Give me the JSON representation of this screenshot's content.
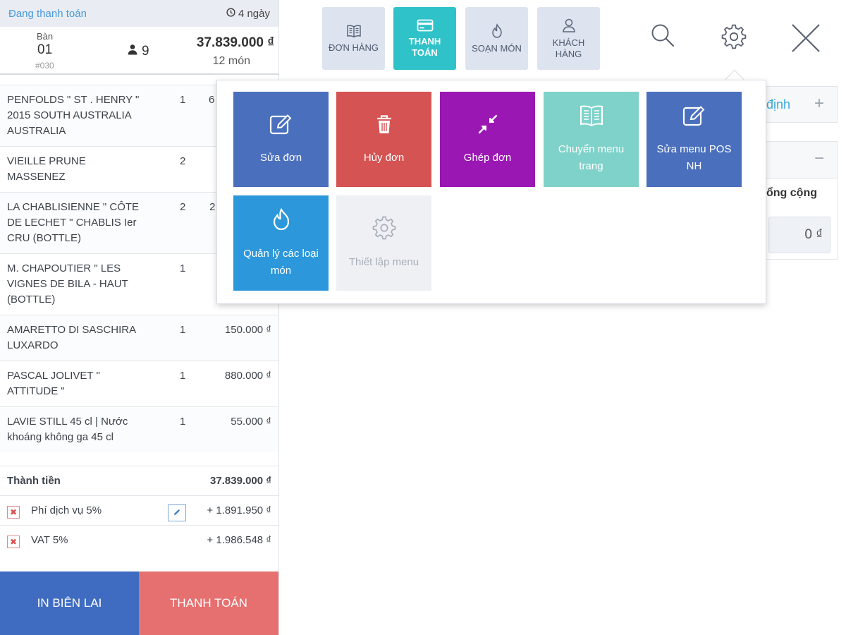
{
  "order": {
    "status": "Đang thanh toán",
    "age": "4 ngày",
    "table_label": "Bàn",
    "table_number": "01",
    "order_code": "#030",
    "guests": "9",
    "total": "37.839.000 ₫",
    "item_count": "12 món"
  },
  "items": [
    {
      "name": "PENFOLDS \" ST . HENRY \" 2015 SOUTH AUSTRALIA AUSTRALIA",
      "qty": "1",
      "price": "6"
    },
    {
      "name": "VIEILLE PRUNE MASSENEZ",
      "qty": "2",
      "price": ""
    },
    {
      "name": "LA CHABLISIENNE \" CÔTE DE LECHET \" CHABLIS Ier CRU (BOTTLE)",
      "qty": "2",
      "price": "2"
    },
    {
      "name": "M. CHAPOUTIER \" LES VIGNES DE BILA - HAUT (BOTTLE)",
      "qty": "1",
      "price": ""
    },
    {
      "name": "AMARETTO DI SASCHIRA LUXARDO",
      "qty": "1",
      "price": "150.000 ₫"
    },
    {
      "name": "PASCAL JOLIVET \" ATTITUDE \"",
      "qty": "1",
      "price": "880.000 ₫"
    },
    {
      "name": "LAVIE STILL 45 cl | Nước khoáng không ga 45 cl",
      "qty": "1",
      "price": "55.000 ₫"
    }
  ],
  "totals": {
    "subtotal_label": "Thành tiền",
    "subtotal_value": "37.839.000 ₫",
    "service_label": "Phí dịch vụ 5%",
    "service_value": "+ 1.891.950 ₫",
    "vat_label": "VAT 5%",
    "vat_value": "+ 1.986.548 ₫"
  },
  "buttons": {
    "print": "IN BIÊN LAI",
    "pay": "THANH TOÁN"
  },
  "tabs": [
    {
      "label1": "ĐƠN HÀNG",
      "label2": "",
      "icon": "book-icon"
    },
    {
      "label1": "THANH",
      "label2": "TOÁN",
      "icon": "credit-card-icon"
    },
    {
      "label1": "SOẠN MÓN",
      "label2": "",
      "icon": "flame-icon"
    },
    {
      "label1": "KHÁCH",
      "label2": "HÀNG",
      "icon": "user-icon"
    }
  ],
  "background": {
    "row1_text": "định",
    "total_label": "ổng cộng",
    "total_value": "0 ₫"
  },
  "menu": [
    {
      "label": "Sửa đơn",
      "color": "#4a6fbd",
      "icon": "edit-icon"
    },
    {
      "label": "Hủy đơn",
      "color": "#d55353",
      "icon": "trash-icon"
    },
    {
      "label": "Ghép đơn",
      "color": "#9b17b3",
      "icon": "merge-icon"
    },
    {
      "label": "Chuyển menu trang",
      "color": "#7fd2c9",
      "icon": "menu-book-icon"
    },
    {
      "label": "Sửa menu POS NH",
      "color": "#4a6fbd",
      "icon": "edit-icon"
    },
    {
      "label": "Quản lý các loại món",
      "color": "#2c97db",
      "icon": "flame-icon"
    },
    {
      "label": "Thiết lập menu",
      "color": "#eef0f4",
      "icon": "gear-icon"
    }
  ],
  "colors": {
    "accent": "#2fc2c9",
    "print_button": "#3f6cc0",
    "pay_button": "#e66f6f"
  }
}
